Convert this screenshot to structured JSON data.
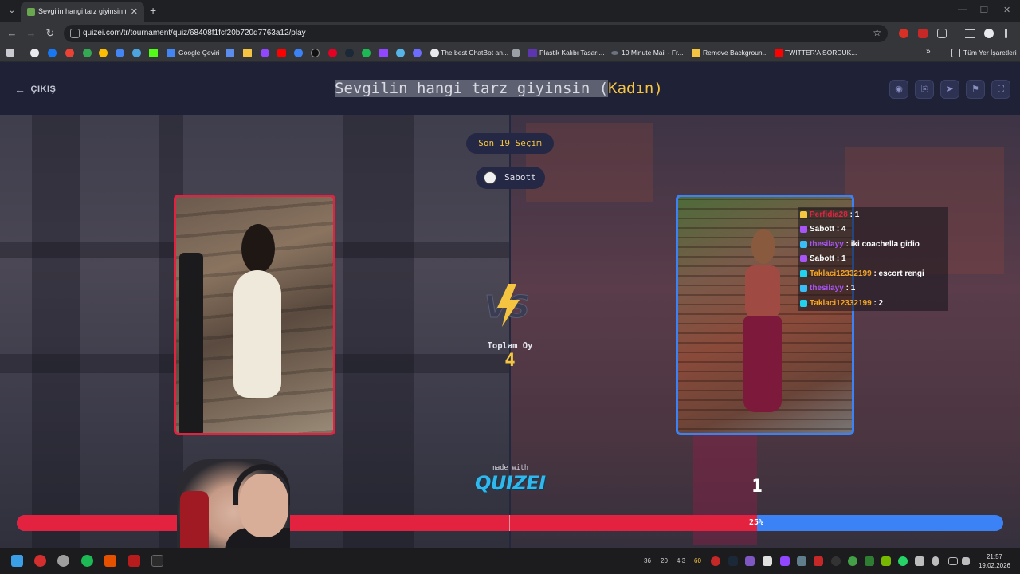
{
  "browser": {
    "tab_title": "Sevgilin hangi tarz giyinsin (Kad",
    "url": "quizei.com/tr/tournament/quiz/68408f1fcf20b720d7763a12/play",
    "bookmarks": [
      {
        "label": "Google Çeviri"
      },
      {
        "label": "The best ChatBot an..."
      },
      {
        "label": "Plastik Kalıbı Tasarı..."
      },
      {
        "label": "10 Minute Mail - Fr..."
      },
      {
        "label": "Remove Backgroun..."
      },
      {
        "label": "TWITTER'A SORDUK..."
      },
      {
        "label": "Tüm Yer İşaretleri"
      }
    ]
  },
  "header": {
    "exit_label": "ÇIKIŞ",
    "title_main": "Sevgilin hangi tarz giyinsin (",
    "title_accent": "Kadın)"
  },
  "round": {
    "label": "Son 19 Seçim",
    "user": "Sabott",
    "total_votes_label": "Toplam Oy",
    "total_votes": "4",
    "right_count": "1",
    "right_percent_label": "25%",
    "left_share": 0.75
  },
  "chat": [
    {
      "user": "Perfidia28",
      "text": " : 1",
      "color": "#e3223f",
      "badge": "#f5c542"
    },
    {
      "user": "Sabott",
      "text": " : 4",
      "color": "#ffffff",
      "badge": "#a855f7"
    },
    {
      "user": "thesilayy",
      "text": " : iki coachella gidio",
      "color": "#a855f7",
      "badge": "#38bdf8"
    },
    {
      "user": "Sabott",
      "text": " : 1",
      "color": "#ffffff",
      "badge": "#a855f7"
    },
    {
      "user": "Taklaci12332199",
      "text": " : escort rengi",
      "color": "#f5a623",
      "badge": "#22d3ee"
    },
    {
      "user": "thesilayy",
      "text": " : 1",
      "color": "#a855f7",
      "badge": "#38bdf8"
    },
    {
      "user": "Taklaci12332199",
      "text": " : 2",
      "color": "#f5a623",
      "badge": "#22d3ee"
    }
  ],
  "footer": {
    "made_with": "made with",
    "brand": "QUIZEI"
  },
  "taskbar": {
    "stats": [
      "36",
      "20",
      "4.3",
      "60"
    ],
    "time": "21:57",
    "date": "19.02.2026"
  },
  "colors": {
    "left_accent": "#e3223f",
    "right_accent": "#3b82f6",
    "gold": "#f5c542"
  }
}
